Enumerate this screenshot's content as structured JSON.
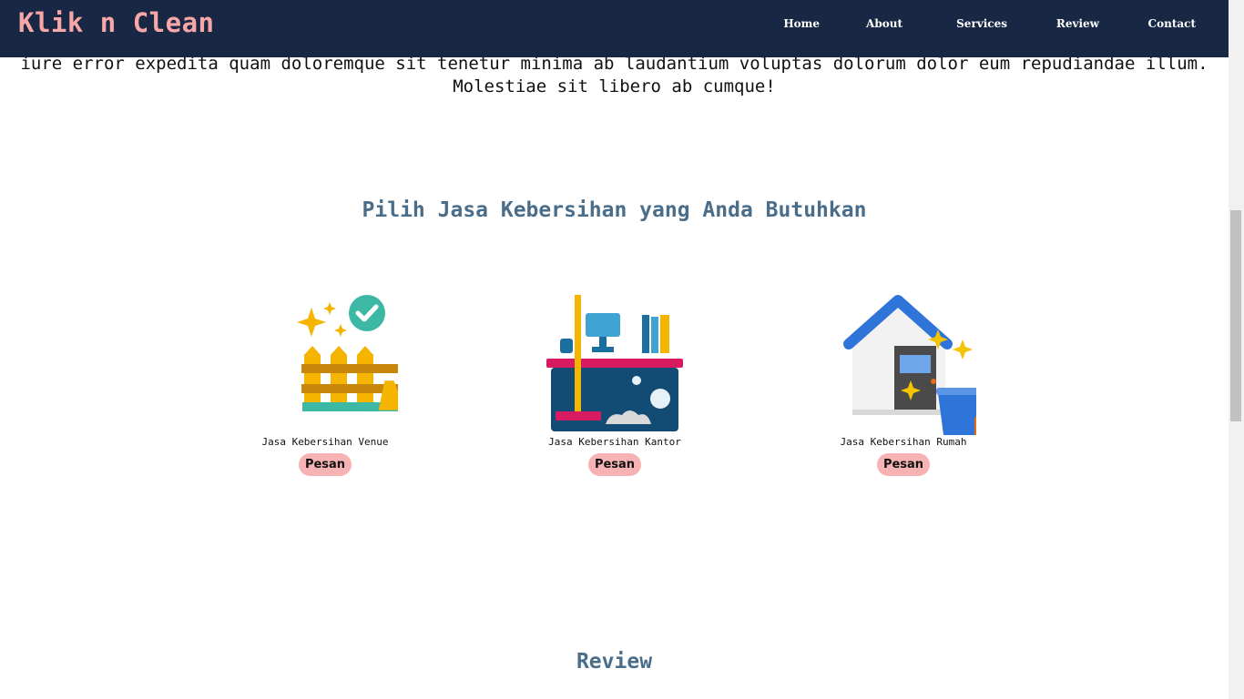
{
  "brand": "Klik n Clean",
  "nav": {
    "home": "Home",
    "about": "About",
    "services": "Services",
    "review": "Review",
    "contact": "Contact"
  },
  "intro": {
    "line1": "iure error expedita quam doloremque sit tenetur minima ab laudantium voluptas dolorum dolor eum repudiandae illum.",
    "line2": "Molestiae sit libero ab cumque!"
  },
  "services": {
    "title": "Pilih Jasa Kebersihan yang Anda Butuhkan",
    "items": [
      {
        "label": "Jasa Kebersihan Venue",
        "button": "Pesan",
        "icon": "fence-broom-sparkle-icon"
      },
      {
        "label": "Jasa Kebersihan Kantor",
        "button": "Pesan",
        "icon": "office-desk-mop-icon"
      },
      {
        "label": "Jasa Kebersihan Rumah",
        "button": "Pesan",
        "icon": "house-bucket-broom-icon"
      }
    ]
  },
  "review": {
    "title": "Review"
  },
  "colors": {
    "navbar": "#172744",
    "brand": "#f7a7a7",
    "heading": "#4a6e8a",
    "button": "#f7b3b3"
  }
}
